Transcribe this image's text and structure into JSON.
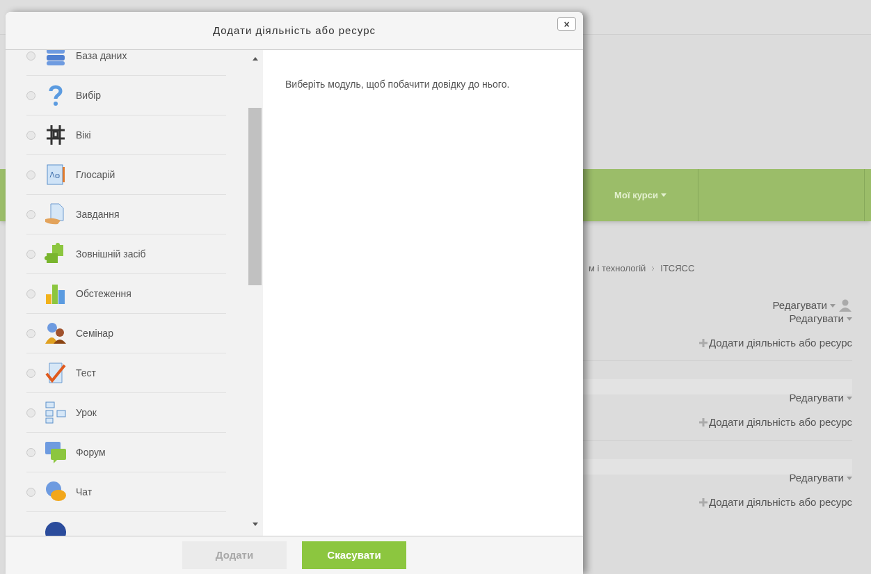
{
  "page": {
    "nav": {
      "label": "Мої курси"
    },
    "breadcrumb": [
      "м і технологій",
      "ITCЯCC"
    ],
    "sections": [
      {
        "edit_labels": [
          "Редагувати",
          "Редагувати"
        ],
        "user_icon": true,
        "add_label": "Додати діяльність або ресурс"
      },
      {
        "edit_labels": [
          "Редагувати"
        ],
        "user_icon": false,
        "add_label": "Додати діяльність або ресурс"
      },
      {
        "edit_labels": [
          "Редагувати"
        ],
        "user_icon": false,
        "add_label": "Додати діяльність або ресурс"
      }
    ]
  },
  "dialog": {
    "title": "Додати діяльність або ресурс",
    "close": "×",
    "modules": [
      {
        "kind": "database",
        "label": "База даних",
        "selected": false
      },
      {
        "kind": "choice",
        "label": "Вибір",
        "selected": false
      },
      {
        "kind": "wiki",
        "label": "Вікі",
        "selected": false
      },
      {
        "kind": "glossary",
        "label": "Глосарій",
        "selected": false
      },
      {
        "kind": "assignment",
        "label": "Завдання",
        "selected": false
      },
      {
        "kind": "external",
        "label": "Зовнішній засіб",
        "selected": false
      },
      {
        "kind": "survey",
        "label": "Обстеження",
        "selected": false
      },
      {
        "kind": "workshop",
        "label": "Семінар",
        "selected": false
      },
      {
        "kind": "quiz",
        "label": "Тест",
        "selected": false
      },
      {
        "kind": "lesson",
        "label": "Урок",
        "selected": false
      },
      {
        "kind": "forum",
        "label": "Форум",
        "selected": false
      },
      {
        "kind": "chat",
        "label": "Чат",
        "selected": false
      }
    ],
    "help": "Виберіть модуль, щоб побачити довідку до нього.",
    "buttons": [
      {
        "label": "Додати",
        "disabled": true
      },
      {
        "label": "Скасувати",
        "disabled": false
      }
    ]
  }
}
